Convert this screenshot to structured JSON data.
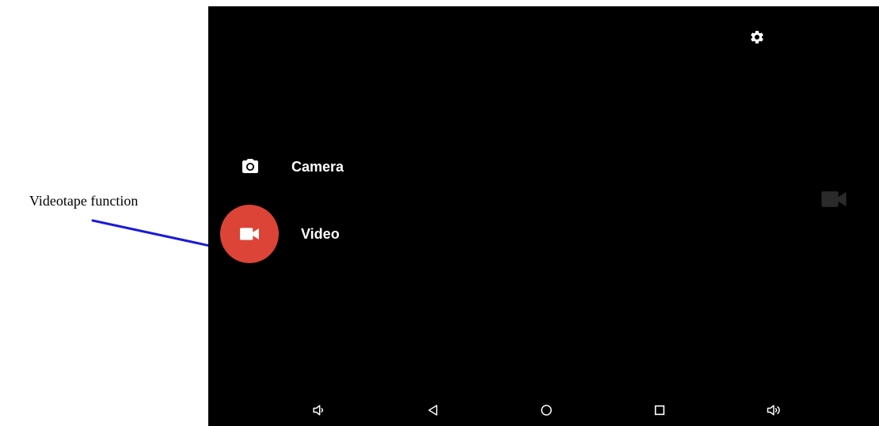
{
  "annotation": {
    "label": "Videotape function",
    "line_color": "#1a1adb"
  },
  "screen": {
    "background": "#000000",
    "settings_icon": "gear-icon",
    "modes": [
      {
        "label": "Camera",
        "icon": "camera-icon",
        "selected": false
      },
      {
        "label": "Video",
        "icon": "videocam-icon",
        "selected": true,
        "accent": "#db4437"
      }
    ],
    "side_indicator_icon": "videocam-icon"
  },
  "nav_bar": {
    "items": [
      {
        "icon": "volume-down-icon"
      },
      {
        "icon": "back-icon"
      },
      {
        "icon": "home-icon"
      },
      {
        "icon": "recents-icon"
      },
      {
        "icon": "volume-up-icon"
      }
    ]
  }
}
